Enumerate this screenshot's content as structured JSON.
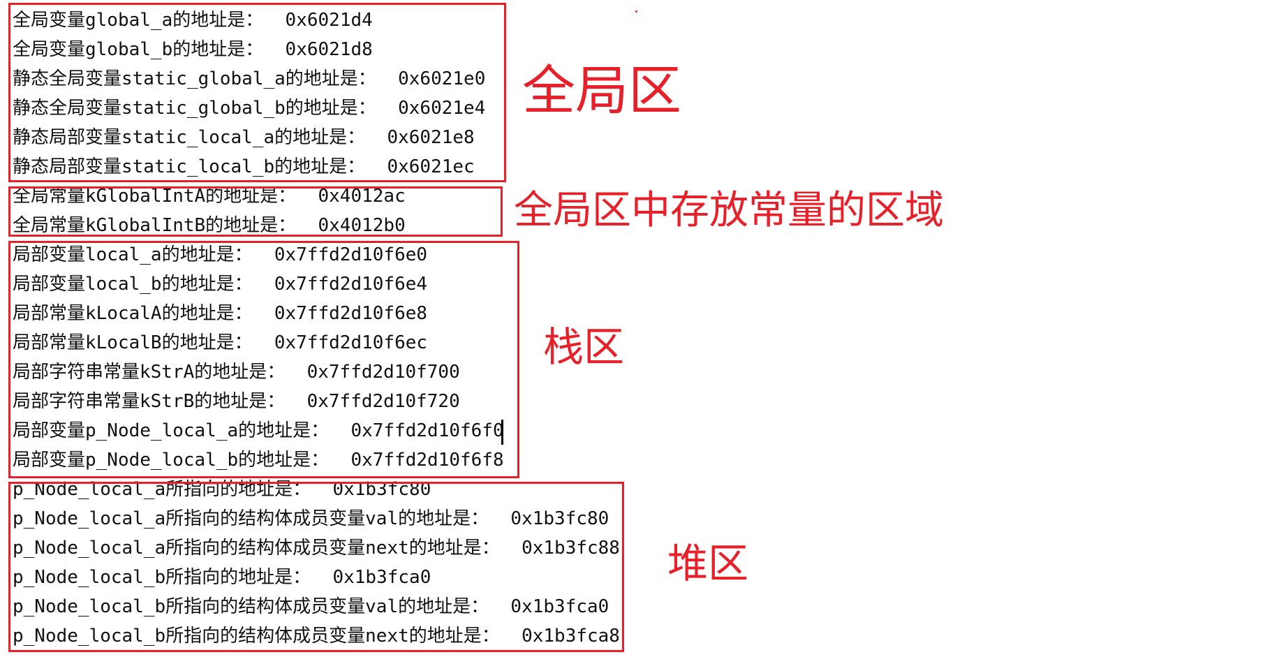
{
  "accent_color": "#e8202a",
  "text_color": "#111111",
  "sections": [
    {
      "label": "全局区",
      "lines": [
        {
          "text": "全局变量global_a的地址是：",
          "value": "0x6021d4"
        },
        {
          "text": "全局变量global_b的地址是：",
          "value": "0x6021d8"
        },
        {
          "text": "静态全局变量static_global_a的地址是：",
          "value": "0x6021e0"
        },
        {
          "text": "静态全局变量static_global_b的地址是：",
          "value": "0x6021e4"
        },
        {
          "text": "静态局部变量static_local_a的地址是：",
          "value": "0x6021e8"
        },
        {
          "text": "静态局部变量static_local_b的地址是：",
          "value": "0x6021ec"
        }
      ]
    },
    {
      "label": "全局区中存放常量的区域",
      "lines": [
        {
          "text": "全局常量kGlobalIntA的地址是：",
          "value": "0x4012ac"
        },
        {
          "text": "全局常量kGlobalIntB的地址是：",
          "value": "0x4012b0"
        }
      ]
    },
    {
      "label": "栈区",
      "lines": [
        {
          "text": "局部变量local_a的地址是：",
          "value": "0x7ffd2d10f6e0"
        },
        {
          "text": "局部变量local_b的地址是：",
          "value": "0x7ffd2d10f6e4"
        },
        {
          "text": "局部常量kLocalA的地址是：",
          "value": "0x7ffd2d10f6e8"
        },
        {
          "text": "局部常量kLocalB的地址是：",
          "value": "0x7ffd2d10f6ec"
        },
        {
          "text": "局部字符串常量kStrA的地址是：",
          "value": "0x7ffd2d10f700"
        },
        {
          "text": "局部字符串常量kStrB的地址是：",
          "value": "0x7ffd2d10f720"
        },
        {
          "text": "局部变量p_Node_local_a的地址是：",
          "value": "0x7ffd2d10f6f0"
        },
        {
          "text": "局部变量p_Node_local_b的地址是：",
          "value": "0x7ffd2d10f6f8"
        }
      ]
    },
    {
      "label": "堆区",
      "lines": [
        {
          "text": "p_Node_local_a所指向的地址是：",
          "value": "0x1b3fc80"
        },
        {
          "text": "p_Node_local_a所指向的结构体成员变量val的地址是：",
          "value": "0x1b3fc80"
        },
        {
          "text": "p_Node_local_a所指向的结构体成员变量next的地址是：",
          "value": "0x1b3fc88"
        },
        {
          "text": "p_Node_local_b所指向的地址是：",
          "value": "0x1b3fca0"
        },
        {
          "text": "p_Node_local_b所指向的结构体成员变量val的地址是：",
          "value": "0x1b3fca0"
        },
        {
          "text": "p_Node_local_b所指向的结构体成员变量next的地址是：",
          "value": "0x1b3fca8"
        }
      ]
    }
  ]
}
